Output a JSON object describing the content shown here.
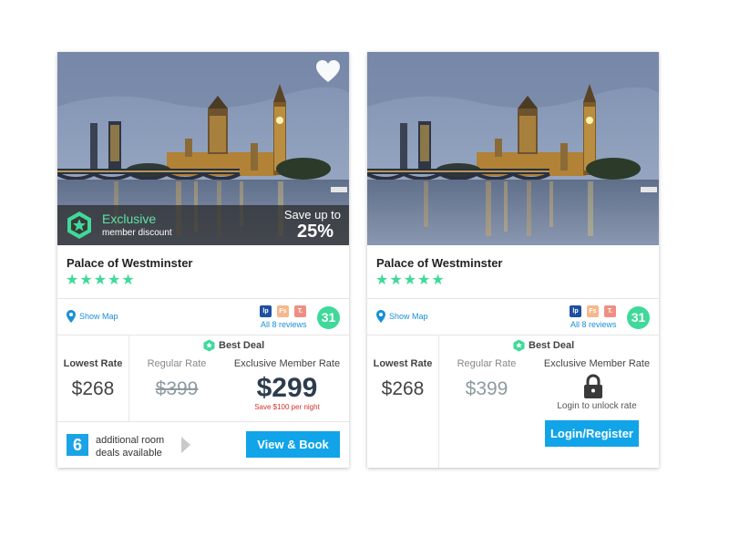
{
  "cards": [
    {
      "hotel_name": "Palace of Westminster",
      "star_rating": 5,
      "favorite_icon": "heart-icon",
      "promo": {
        "title": "Exclusive",
        "subtitle": "member discount",
        "save_label": "Save up to",
        "save_percent": "25%"
      },
      "show_map": "Show Map",
      "review_sources": [
        "lp",
        "Fs",
        "T."
      ],
      "reviews_link": "All 8 reviews",
      "score": "31",
      "best_deal": "Best Deal",
      "columns": {
        "lowest": "Lowest Rate",
        "regular": "Regular Rate",
        "member": "Exclusive Member Rate"
      },
      "prices": {
        "lowest": "$268",
        "regular": "$399",
        "member": "$299",
        "save_note": "Save $100 per night"
      },
      "deals": {
        "count": "6",
        "line1": "additional room",
        "line2": "deals available"
      },
      "view_button": "View & Book"
    },
    {
      "hotel_name": "Palace of Westminster",
      "star_rating": 5,
      "show_map": "Show Map",
      "review_sources": [
        "lp",
        "Fs",
        "T."
      ],
      "reviews_link": "All 8 reviews",
      "score": "31",
      "best_deal": "Best Deal",
      "columns": {
        "lowest": "Lowest Rate",
        "regular": "Regular Rate",
        "member": "Exclusive Member Rate"
      },
      "prices": {
        "lowest": "$268",
        "regular": "$399"
      },
      "lock_icon": "lock-icon",
      "unlock_text": "Login to unlock rate",
      "login_button": "Login/Register"
    }
  ],
  "colors": {
    "accent_green": "#3fd99a",
    "button_blue": "#12a4e8",
    "link_blue": "#1a8fd8",
    "save_red": "#d9302c"
  }
}
